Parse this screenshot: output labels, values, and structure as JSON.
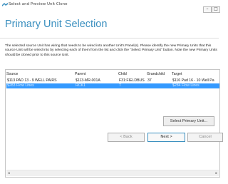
{
  "window": {
    "title": "Select and Preview Unit Clone",
    "minimize_label": "–",
    "maximize_label": "□"
  },
  "page": {
    "heading": "Primary Unit Selection",
    "description": "The selected source Unit has wiring that needs to be wired into another Unit's Panel(s). Please identify the new Primary Units that this source Unit will be wired into by selecting each of them from the list and click the \"Select Primary Unit\" button. Note the new Primary Units should be cloned prior to this source Unit."
  },
  "table": {
    "columns": [
      "Source",
      "Parent",
      "Child",
      "Grandchild",
      "Target"
    ],
    "rows": [
      {
        "source": "$113 PAD 13 - 9 WELL PAIRS",
        "parent": "$113-MR-001A",
        "child": "F31:FIELDBUS",
        "grandchild": "37",
        "target": "$116 Pad 16 - 10 Well Pa",
        "selected": false
      },
      {
        "source": "$283 Flow Lines",
        "parent": "RCK1",
        "child": "T",
        "grandchild": "",
        "target": "$284 Flow Lines",
        "selected": true
      }
    ],
    "scroll_left": "◂",
    "scroll_right": "▸"
  },
  "buttons": {
    "select_primary": "Select Primary Unit...",
    "back": "< Back",
    "next": "Next >",
    "cancel": "Cancel"
  },
  "colors": {
    "accent": "#3a8fbf",
    "selection": "#3399ff"
  }
}
